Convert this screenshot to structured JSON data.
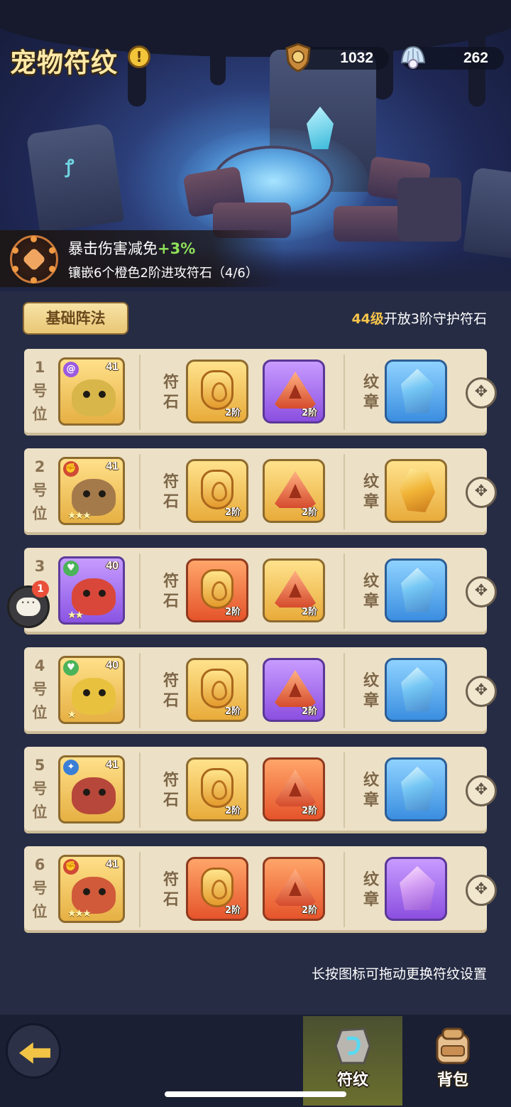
{
  "page": {
    "title": "宠物符纹",
    "info_icon": "info-icon"
  },
  "currencies": [
    {
      "name": "honor-badge",
      "icon": "shield-medal-icon",
      "value": "1032"
    },
    {
      "name": "pearl-shell",
      "icon": "shell-pearl-icon",
      "value": "262"
    }
  ],
  "bonus": {
    "effect": "暴击伤害减免",
    "amount": "+3%",
    "requirement": "镶嵌6个橙色2阶进攻符石（4/6）"
  },
  "formation": {
    "tab_label": "基础阵法",
    "unlock_level": "44级",
    "unlock_text": "开放3阶守护符石"
  },
  "labels": {
    "rune": "符石",
    "emblem": "纹章",
    "tier": "2阶"
  },
  "slots": [
    {
      "pos": "1号位",
      "pet_level": "41",
      "pet_frame": "gold",
      "pet_tribe": "spiral",
      "pet_stars": "",
      "rune1": "gold",
      "rune2": "purple",
      "emblem": "blue-crystal"
    },
    {
      "pos": "2号位",
      "pet_level": "41",
      "pet_frame": "gold",
      "pet_tribe": "fist",
      "pet_stars": "★★★",
      "rune1": "gold",
      "rune2": "gold",
      "emblem": "amber-crystal"
    },
    {
      "pos": "3号位",
      "pet_level": "40",
      "pet_frame": "purple",
      "pet_tribe": "heart",
      "pet_stars": "★★",
      "rune1": "orange",
      "rune2": "gold",
      "emblem": "blue-crystal"
    },
    {
      "pos": "4号位",
      "pet_level": "40",
      "pet_frame": "gold",
      "pet_tribe": "heart",
      "pet_stars": "★",
      "rune1": "gold",
      "rune2": "purple",
      "emblem": "blue-crystal"
    },
    {
      "pos": "5号位",
      "pet_level": "41",
      "pet_frame": "gold",
      "pet_tribe": "magic",
      "pet_stars": "",
      "rune1": "gold",
      "rune2": "orange",
      "emblem": "blue-crystal"
    },
    {
      "pos": "6号位",
      "pet_level": "41",
      "pet_frame": "gold",
      "pet_tribe": "fist",
      "pet_stars": "★★★",
      "rune1": "orange",
      "rune2": "orange",
      "emblem": "purple-crystal"
    }
  ],
  "chat": {
    "badge": "1"
  },
  "hint": "长按图标可拖动更换符纹设置",
  "nav": {
    "tabs": [
      {
        "label": "符纹",
        "icon": "rune-stone-icon",
        "active": true
      },
      {
        "label": "背包",
        "icon": "backpack-icon",
        "active": false
      }
    ]
  },
  "colors": {
    "background": "#262c44",
    "panel": "#ece0c6",
    "title_gold": "#ffe9a8",
    "bonus_green": "#8fe05a",
    "level_gold": "#f5c44a"
  }
}
